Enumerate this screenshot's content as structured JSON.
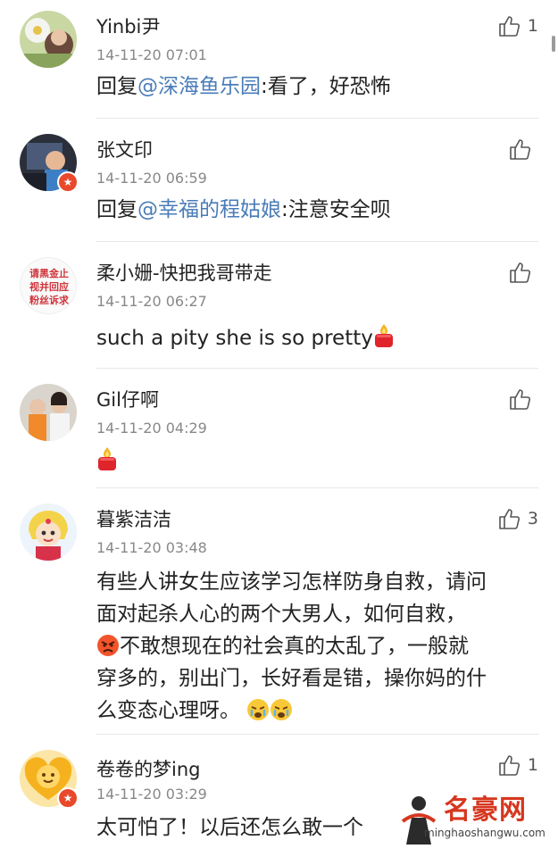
{
  "comments": [
    {
      "name": "Yinbi尹",
      "time": "14-11-20 07:01",
      "reply_prefix": "回复",
      "mention": "@深海鱼乐园",
      "text": ":看了，好恐怖",
      "likes": "1"
    },
    {
      "name": "张文印",
      "time": "14-11-20 06:59",
      "reply_prefix": "回复",
      "mention": "@幸福的程姑娘",
      "text": ":注意安全呗",
      "likes": ""
    },
    {
      "name": "柔小姗-快把我哥带走",
      "time": "14-11-20 06:27",
      "text": "such a pity she is so pretty",
      "likes": "",
      "avatar_text": [
        "请黑金止",
        "视并回应",
        "粉丝诉求"
      ]
    },
    {
      "name": "Gil仔啊",
      "time": "14-11-20 04:29",
      "text": "",
      "likes": ""
    },
    {
      "name": "暮紫洁洁",
      "time": "14-11-20 03:48",
      "text_lines": [
        "有些人讲女生应该学习怎样防身自救，请问",
        "面对起杀人心的两个大男人，如何自救，",
        "不敢想现在的社会真的太乱了，一般就",
        "穿多的，别出门，长好看是错，操你妈的什",
        "么变态心理呀。"
      ],
      "likes": "3"
    },
    {
      "name": "卷卷的梦ing",
      "time": "14-11-20 03:29",
      "text": "太可怕了！以后还怎么敢一个",
      "likes": "1"
    }
  ],
  "watermark": {
    "title": "名豪网",
    "url": "minghaoshangwu.com"
  },
  "colors": {
    "mention": "#4a7cb8",
    "time": "#888888",
    "divider": "#e8e8e8",
    "watermark": "#d6371f"
  }
}
